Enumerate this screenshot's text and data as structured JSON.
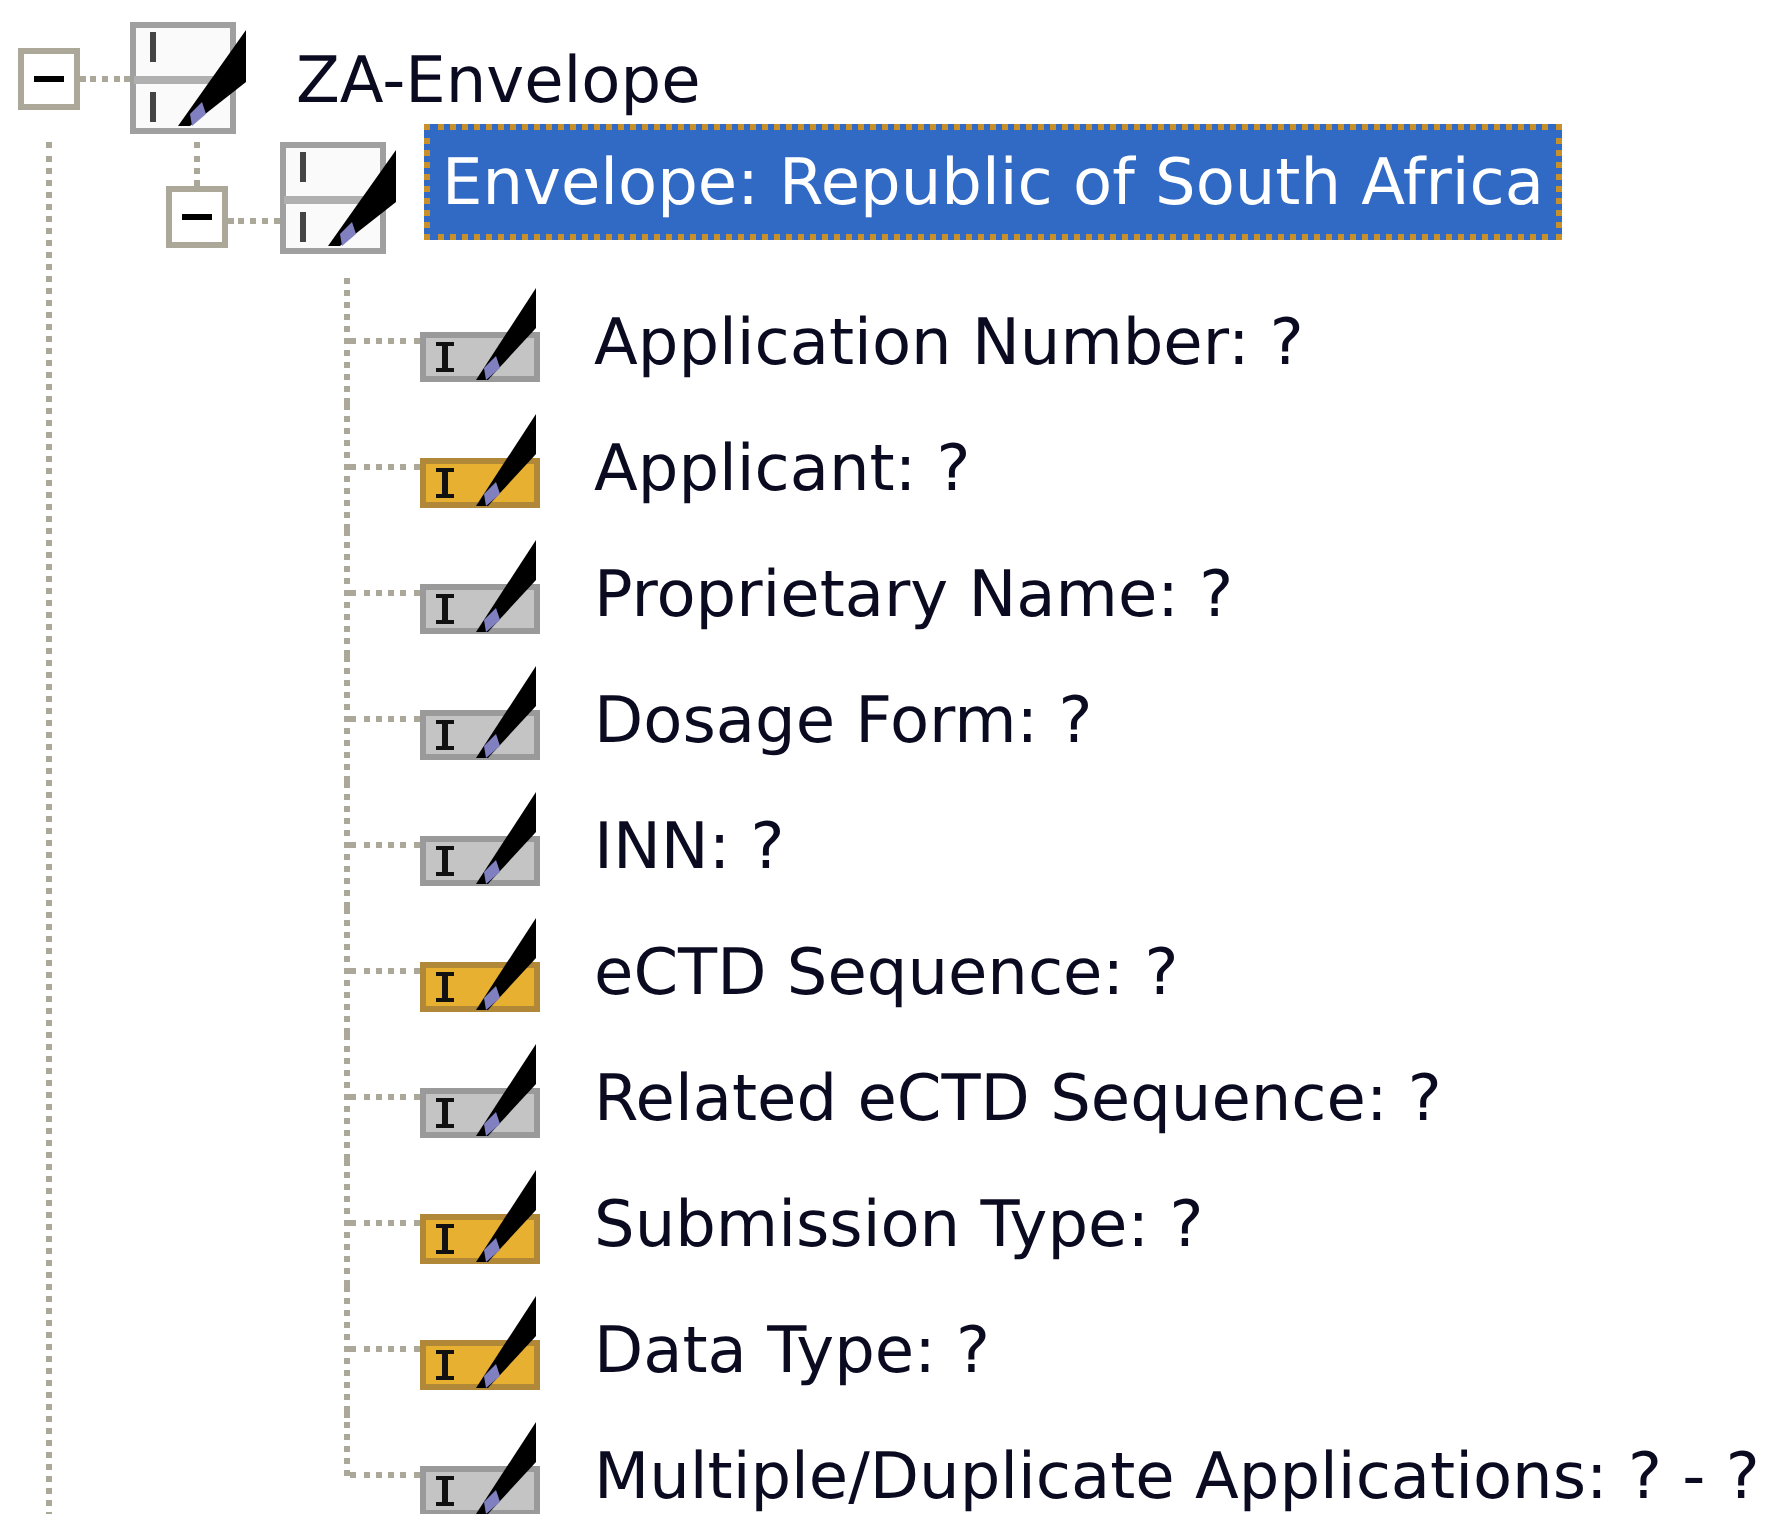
{
  "tree": {
    "label": "ZA-Envelope",
    "expanded": true,
    "selected": false,
    "children": [
      {
        "label": "Envelope: Republic of South Africa",
        "expanded": true,
        "selected": true,
        "children": [
          {
            "label": "Application Number: ?",
            "flagged": false,
            "selected": false
          },
          {
            "label": "Applicant: ?",
            "flagged": true,
            "selected": false
          },
          {
            "label": "Proprietary Name: ?",
            "flagged": false,
            "selected": false
          },
          {
            "label": "Dosage Form: ?",
            "flagged": false,
            "selected": false
          },
          {
            "label": "INN: ?",
            "flagged": false,
            "selected": false
          },
          {
            "label": "eCTD Sequence: ?",
            "flagged": true,
            "selected": false
          },
          {
            "label": "Related eCTD Sequence: ?",
            "flagged": false,
            "selected": false
          },
          {
            "label": "Submission Type: ?",
            "flagged": true,
            "selected": false
          },
          {
            "label": "Data Type: ?",
            "flagged": true,
            "selected": false
          },
          {
            "label": "Multiple/Duplicate Applications: ? - ?",
            "flagged": false,
            "selected": false
          }
        ]
      }
    ]
  }
}
